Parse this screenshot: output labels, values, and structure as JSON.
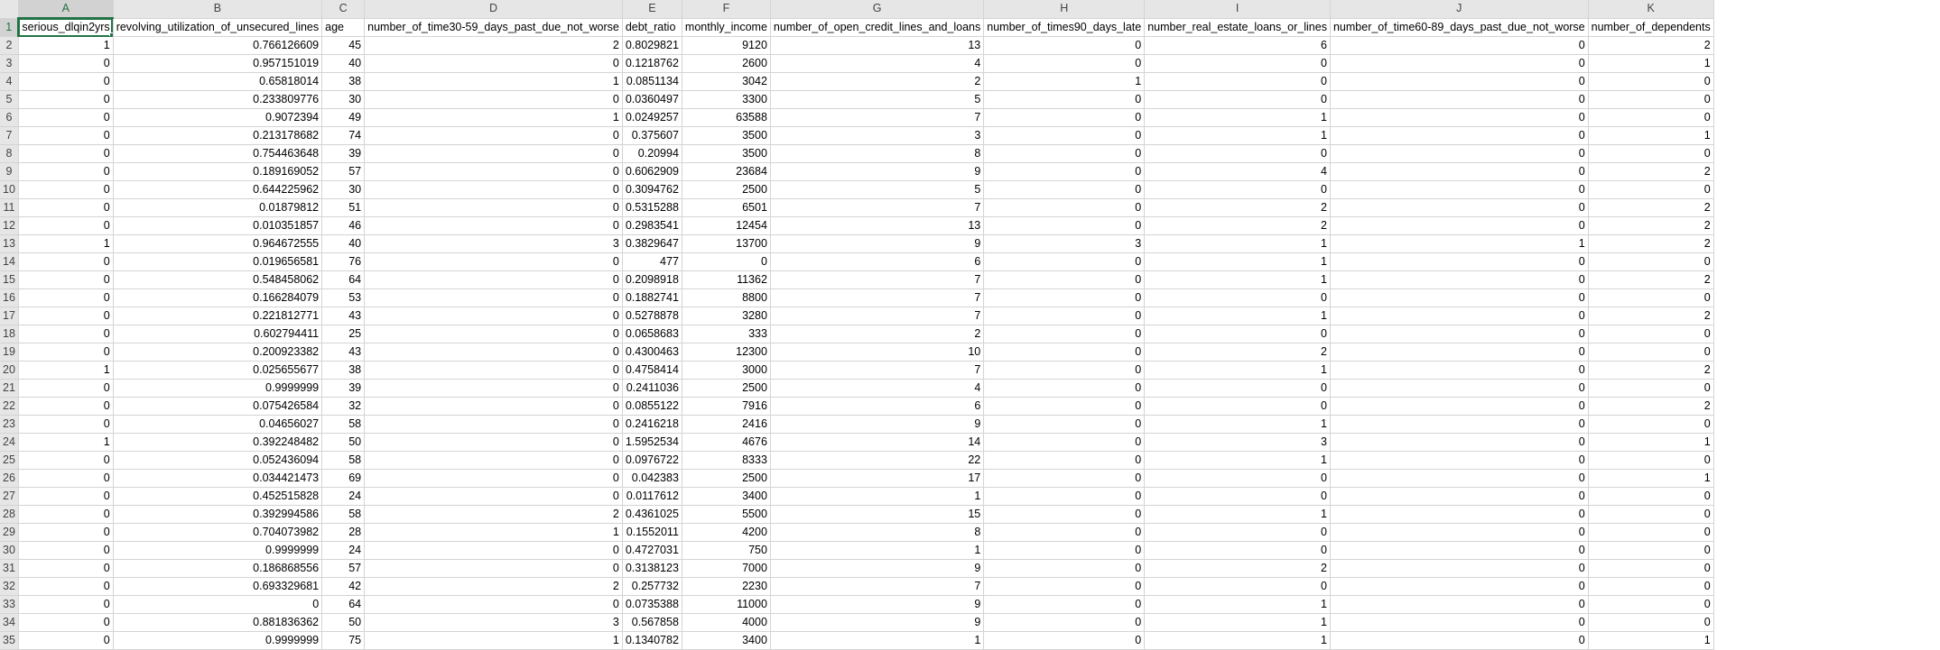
{
  "sheet": {
    "column_letters": [
      "A",
      "B",
      "C",
      "D",
      "E",
      "F",
      "G",
      "H",
      "I",
      "J",
      "K"
    ],
    "active_cell": "A1",
    "header_row": [
      "serious_dlqin2yrs",
      "revolving_utilization_of_unsecured_lines",
      "age",
      "number_of_time30-59_days_past_due_not_worse",
      "debt_ratio",
      "monthly_income",
      "number_of_open_credit_lines_and_loans",
      "number_of_times90_days_late",
      "number_real_estate_loans_or_lines",
      "number_of_time60-89_days_past_due_not_worse",
      "number_of_dependents"
    ],
    "rows": [
      [
        "1",
        "0.766126609",
        "45",
        "2",
        "0.8029821",
        "9120",
        "13",
        "0",
        "6",
        "0",
        "2"
      ],
      [
        "0",
        "0.957151019",
        "40",
        "0",
        "0.1218762",
        "2600",
        "4",
        "0",
        "0",
        "0",
        "1"
      ],
      [
        "0",
        "0.65818014",
        "38",
        "1",
        "0.0851134",
        "3042",
        "2",
        "1",
        "0",
        "0",
        "0"
      ],
      [
        "0",
        "0.233809776",
        "30",
        "0",
        "0.0360497",
        "3300",
        "5",
        "0",
        "0",
        "0",
        "0"
      ],
      [
        "0",
        "0.9072394",
        "49",
        "1",
        "0.0249257",
        "63588",
        "7",
        "0",
        "1",
        "0",
        "0"
      ],
      [
        "0",
        "0.213178682",
        "74",
        "0",
        "0.375607",
        "3500",
        "3",
        "0",
        "1",
        "0",
        "1"
      ],
      [
        "0",
        "0.754463648",
        "39",
        "0",
        "0.20994",
        "3500",
        "8",
        "0",
        "0",
        "0",
        "0"
      ],
      [
        "0",
        "0.189169052",
        "57",
        "0",
        "0.6062909",
        "23684",
        "9",
        "0",
        "4",
        "0",
        "2"
      ],
      [
        "0",
        "0.644225962",
        "30",
        "0",
        "0.3094762",
        "2500",
        "5",
        "0",
        "0",
        "0",
        "0"
      ],
      [
        "0",
        "0.01879812",
        "51",
        "0",
        "0.5315288",
        "6501",
        "7",
        "0",
        "2",
        "0",
        "2"
      ],
      [
        "0",
        "0.010351857",
        "46",
        "0",
        "0.2983541",
        "12454",
        "13",
        "0",
        "2",
        "0",
        "2"
      ],
      [
        "1",
        "0.964672555",
        "40",
        "3",
        "0.3829647",
        "13700",
        "9",
        "3",
        "1",
        "1",
        "2"
      ],
      [
        "0",
        "0.019656581",
        "76",
        "0",
        "477",
        "0",
        "6",
        "0",
        "1",
        "0",
        "0"
      ],
      [
        "0",
        "0.548458062",
        "64",
        "0",
        "0.2098918",
        "11362",
        "7",
        "0",
        "1",
        "0",
        "2"
      ],
      [
        "0",
        "0.166284079",
        "53",
        "0",
        "0.1882741",
        "8800",
        "7",
        "0",
        "0",
        "0",
        "0"
      ],
      [
        "0",
        "0.221812771",
        "43",
        "0",
        "0.5278878",
        "3280",
        "7",
        "0",
        "1",
        "0",
        "2"
      ],
      [
        "0",
        "0.602794411",
        "25",
        "0",
        "0.0658683",
        "333",
        "2",
        "0",
        "0",
        "0",
        "0"
      ],
      [
        "0",
        "0.200923382",
        "43",
        "0",
        "0.4300463",
        "12300",
        "10",
        "0",
        "2",
        "0",
        "0"
      ],
      [
        "1",
        "0.025655677",
        "38",
        "0",
        "0.4758414",
        "3000",
        "7",
        "0",
        "1",
        "0",
        "2"
      ],
      [
        "0",
        "0.9999999",
        "39",
        "0",
        "0.2411036",
        "2500",
        "4",
        "0",
        "0",
        "0",
        "0"
      ],
      [
        "0",
        "0.075426584",
        "32",
        "0",
        "0.0855122",
        "7916",
        "6",
        "0",
        "0",
        "0",
        "2"
      ],
      [
        "0",
        "0.04656027",
        "58",
        "0",
        "0.2416218",
        "2416",
        "9",
        "0",
        "1",
        "0",
        "0"
      ],
      [
        "1",
        "0.392248482",
        "50",
        "0",
        "1.5952534",
        "4676",
        "14",
        "0",
        "3",
        "0",
        "1"
      ],
      [
        "0",
        "0.052436094",
        "58",
        "0",
        "0.0976722",
        "8333",
        "22",
        "0",
        "1",
        "0",
        "0"
      ],
      [
        "0",
        "0.034421473",
        "69",
        "0",
        "0.042383",
        "2500",
        "17",
        "0",
        "0",
        "0",
        "1"
      ],
      [
        "0",
        "0.452515828",
        "24",
        "0",
        "0.0117612",
        "3400",
        "1",
        "0",
        "0",
        "0",
        "0"
      ],
      [
        "0",
        "0.392994586",
        "58",
        "2",
        "0.4361025",
        "5500",
        "15",
        "0",
        "1",
        "0",
        "0"
      ],
      [
        "0",
        "0.704073982",
        "28",
        "1",
        "0.1552011",
        "4200",
        "8",
        "0",
        "0",
        "0",
        "0"
      ],
      [
        "0",
        "0.9999999",
        "24",
        "0",
        "0.4727031",
        "750",
        "1",
        "0",
        "0",
        "0",
        "0"
      ],
      [
        "0",
        "0.186868556",
        "57",
        "0",
        "0.3138123",
        "7000",
        "9",
        "0",
        "2",
        "0",
        "0"
      ],
      [
        "0",
        "0.693329681",
        "42",
        "2",
        "0.257732",
        "2230",
        "7",
        "0",
        "0",
        "0",
        "0"
      ],
      [
        "0",
        "0",
        "64",
        "0",
        "0.0735388",
        "11000",
        "9",
        "0",
        "1",
        "0",
        "0"
      ],
      [
        "0",
        "0.881836362",
        "50",
        "3",
        "0.567858",
        "4000",
        "9",
        "0",
        "1",
        "0",
        "0"
      ],
      [
        "0",
        "0.9999999",
        "75",
        "1",
        "0.1340782",
        "3400",
        "1",
        "0",
        "1",
        "0",
        "1"
      ]
    ]
  },
  "colors": {
    "header_bg": "#e6e6e6",
    "gridline": "#d4d4d4",
    "selection": "#217346"
  }
}
